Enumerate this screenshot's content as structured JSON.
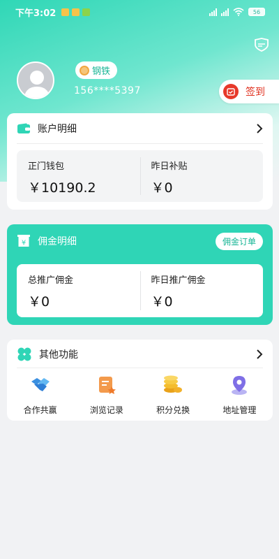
{
  "status_bar": {
    "time": "下午3:02",
    "battery": "56"
  },
  "profile": {
    "level": "钢铁",
    "phone": "156****5397",
    "checkin_label": "签到"
  },
  "account": {
    "title": "账户明细",
    "wallet_label": "正门钱包",
    "wallet_value": "￥10190.2",
    "subsidy_label": "昨日补贴",
    "subsidy_value": "￥0"
  },
  "commission": {
    "title": "佣金明细",
    "orders_button": "佣金订单",
    "total_label": "总推广佣金",
    "total_value": "￥0",
    "yesterday_label": "昨日推广佣金",
    "yesterday_value": "￥0"
  },
  "other": {
    "title": "其他功能",
    "items": [
      {
        "label": "合作共赢",
        "icon": "handshake-icon"
      },
      {
        "label": "浏览记录",
        "icon": "history-icon"
      },
      {
        "label": "积分兑换",
        "icon": "coins-icon"
      },
      {
        "label": "地址管理",
        "icon": "location-icon"
      }
    ]
  },
  "colors": {
    "accent": "#2fd5b6",
    "checkin_red": "#e0301e"
  }
}
